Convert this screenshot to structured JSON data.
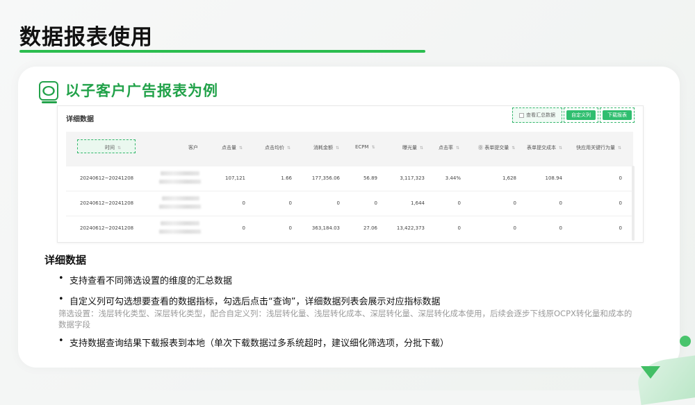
{
  "page": {
    "title": "数据报表使用",
    "section_title": "以子客户广告报表为例",
    "accent_color": "#2bbd4f"
  },
  "screenshot": {
    "title": "详细数据",
    "checkbox_label": "查看汇总数据",
    "btn_custom": "自定义列",
    "btn_download": "下载报表",
    "columns": [
      "时间",
      "客户",
      "点击量",
      "点击均价",
      "消耗金额",
      "ECPM",
      "曝光量",
      "点击率",
      "⓪ 表单提交量",
      "表单提交成本",
      "快应用关键行为量"
    ],
    "rows": [
      {
        "time": "20240612~20241208",
        "clicks": "107,121",
        "cpc": "1.66",
        "cost": "177,356.06",
        "ecpm": "56.89",
        "impr": "3,117,323",
        "ctr": "3.44%",
        "forms": "1,628",
        "form_cost": "108.94",
        "quickapp": "0"
      },
      {
        "time": "20240612~20241208",
        "clicks": "0",
        "cpc": "0",
        "cost": "0",
        "ecpm": "0",
        "impr": "1,644",
        "ctr": "0",
        "forms": "0",
        "form_cost": "0",
        "quickapp": "0"
      },
      {
        "time": "20240612~20241208",
        "clicks": "0",
        "cpc": "0",
        "cost": "363,184.03",
        "ecpm": "27.06",
        "impr": "13,422,373",
        "ctr": "0",
        "forms": "0",
        "form_cost": "0",
        "quickapp": "0"
      }
    ]
  },
  "content": {
    "heading": "详细数据",
    "bullet1": "支持查看不同筛选设置的维度的汇总数据",
    "bullet2": "自定义列可勾选想要查看的数据指标，勾选后点击“查询”，详细数据列表会展示对应指标数据",
    "note": "筛选设置：浅层转化类型、深层转化类型，配合自定义列：浅层转化量、浅层转化成本、深层转化量、深层转化成本使用，后续会逐步下线原OCPX转化量和成本的数据字段",
    "bullet3": "支持数据查询结果下载报表到本地（单次下载数据过多系统超时，建议细化筛选项，分批下载）"
  }
}
